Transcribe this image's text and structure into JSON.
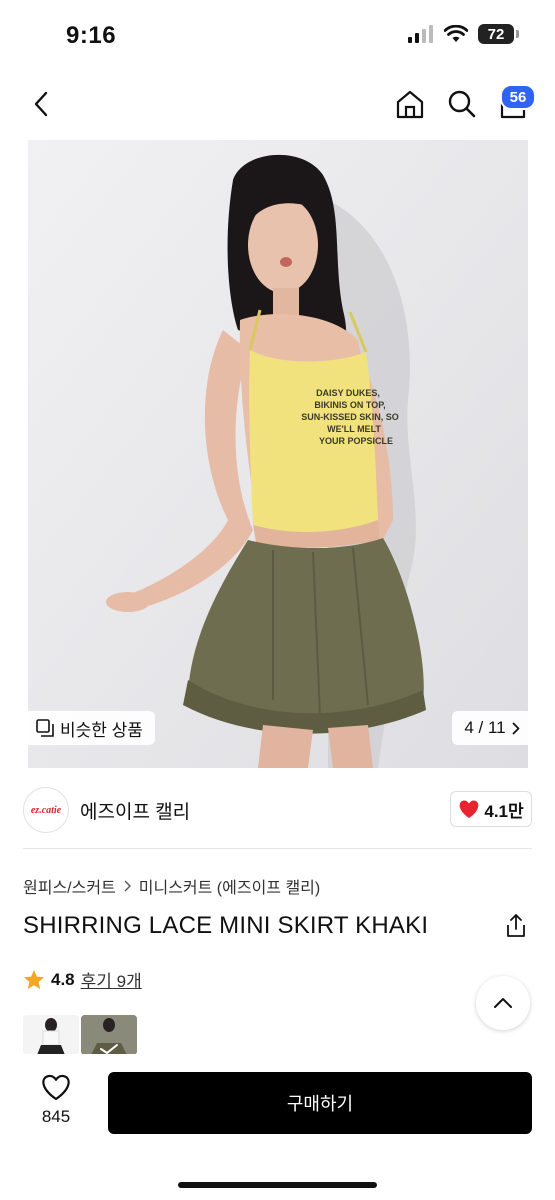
{
  "status_bar": {
    "time": "9:16",
    "battery": "72"
  },
  "nav": {
    "cart_count": "56"
  },
  "gallery": {
    "similar_label": "비슷한 상품",
    "page_indicator": "4 / 11",
    "shirt_text": [
      "DAISY DUKES,",
      "BIKINIS ON TOP,",
      "SUN-KISSED SKIN, SO",
      "WE'LL MELT",
      "YOUR POPSICLE"
    ]
  },
  "shop": {
    "logo_text": "ez.catie",
    "name": "에즈이프 캘리",
    "likes": "4.1만"
  },
  "breadcrumb": {
    "category": "원피스/스커트",
    "subcategory": "미니스커트 (에즈이프 캘리)"
  },
  "product": {
    "title": "SHIRRING LACE MINI SKIRT KHAKI",
    "rating": "4.8",
    "review_link": "후기 9개"
  },
  "bottom_bar": {
    "like_count": "845",
    "buy_label": "구매하기"
  },
  "colors": {
    "accent": "#2f63f2",
    "like_red": "#e8242f",
    "star": "#f5a623"
  },
  "icons": [
    "back-icon",
    "home-icon",
    "search-icon",
    "cart-icon",
    "similar-icon",
    "chevron-right-icon",
    "heart-icon",
    "share-icon",
    "star-icon",
    "chevron-up-icon"
  ]
}
